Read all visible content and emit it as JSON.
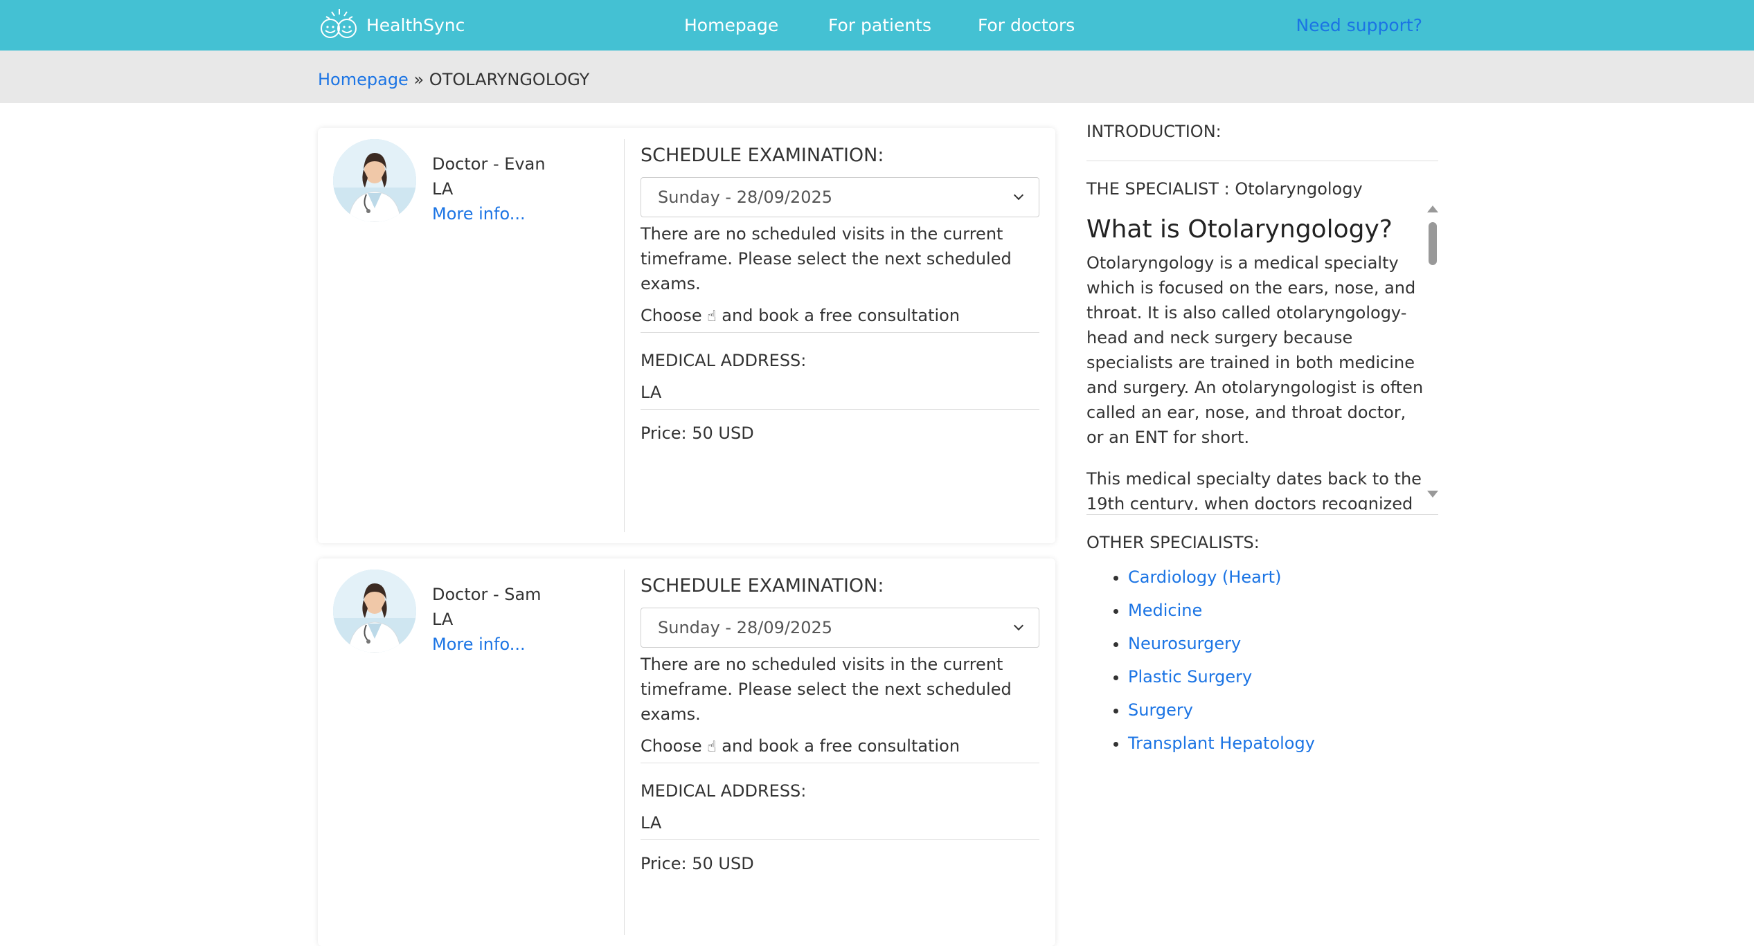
{
  "header": {
    "logo_text": "HealthSync",
    "nav": [
      "Homepage",
      "For patients",
      "For doctors"
    ],
    "support": "Need support?"
  },
  "breadcrumb": {
    "home": "Homepage",
    "separator": "»",
    "current": "OTOLARYNGOLOGY"
  },
  "doctors": [
    {
      "name": "Doctor - Evan",
      "location": "LA",
      "more": "More info...",
      "schedule_title": "SCHEDULE EXAMINATION:",
      "date_selected": "Sunday - 28/09/2025",
      "no_slots": "There are no scheduled visits in the current timeframe. Please select the next scheduled exams.",
      "choose_prefix": "Choose",
      "choose_suffix": "and book a free consultation",
      "address_label": "MEDICAL ADDRESS:",
      "address": "LA",
      "price": "Price: 50 USD"
    },
    {
      "name": "Doctor - Sam",
      "location": "LA",
      "more": "More info...",
      "schedule_title": "SCHEDULE EXAMINATION:",
      "date_selected": "Sunday - 28/09/2025",
      "no_slots": "There are no scheduled visits in the current timeframe. Please select the next scheduled exams.",
      "choose_prefix": "Choose",
      "choose_suffix": "and book a free consultation",
      "address_label": "MEDICAL ADDRESS:",
      "address": "LA",
      "price": "Price: 50 USD"
    }
  ],
  "sidebar": {
    "intro_heading": "INTRODUCTION:",
    "specialist_line": "THE SPECIALIST : Otolaryngology",
    "question": "What is Otolaryngology?",
    "para1": "Otolaryngology is a medical specialty which is focused on the ears, nose, and throat. It is also called otolaryngology-head and neck surgery because specialists are trained in both medicine and surgery. An otolaryngologist is often called an ear, nose, and throat doctor, or an ENT for short.",
    "para2": "This medical specialty dates back to the 19th century, when doctors recognized",
    "others_heading": "OTHER SPECIALISTS:",
    "others": [
      "Cardiology (Heart)",
      "Medicine",
      "Neurosurgery",
      "Plastic Surgery",
      "Surgery",
      "Transplant Hepatology"
    ]
  },
  "colors": {
    "header_bg": "#44c1d3",
    "link": "#1b74e4",
    "crumb_bg": "#e8e8e8"
  }
}
